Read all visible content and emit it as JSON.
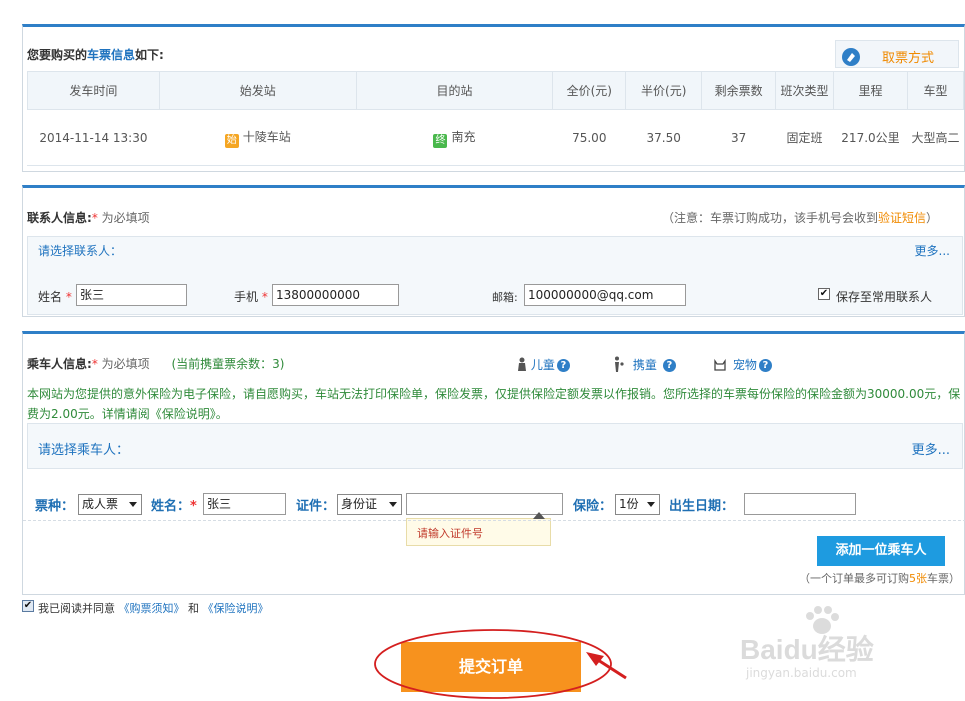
{
  "ticket_panel": {
    "heading_prefix": "您要购买的",
    "heading_highlight": "车票信息",
    "heading_suffix": "如下:",
    "pickup_label": "取票方式",
    "columns": [
      "发车时间",
      "始发站",
      "目的站",
      "全价(元)",
      "半价(元)",
      "剩余票数",
      "班次类型",
      "里程",
      "车型"
    ],
    "row": {
      "depart_time": "2014-11-14 13:30",
      "start_tag": "始",
      "start_station": "十陵车站",
      "end_tag": "终",
      "end_station": "南充",
      "full_price": "75.00",
      "half_price": "37.50",
      "remaining": "37",
      "service_type": "固定班",
      "distance": "217.0公里",
      "vehicle": "大型高二"
    }
  },
  "contact_panel": {
    "heading": "联系人信息:",
    "required_mark": "*",
    "required_text": "为必填项",
    "notice_prefix": "（注意：车票订购成功，该手机号会收到",
    "notice_link": "验证短信",
    "notice_suffix": "）",
    "select_prompt": "请选择联系人：",
    "more": "更多...",
    "name_label": "姓名",
    "name_value": "张三",
    "phone_label": "手机",
    "phone_value": "13800000000",
    "email_label": "邮箱:",
    "email_value": "100000000@qq.com",
    "save_label": "保存至常用联系人",
    "save_checked": "✔"
  },
  "passenger_panel": {
    "heading": "乘车人信息:",
    "required_mark": "*",
    "required_text": "为必填项",
    "child_count": "(当前携童票余数：3)",
    "child_label": "儿童",
    "carry_child_label": "携童",
    "pet_label": "宠物",
    "help_glyph": "?",
    "insurance_notice": "本网站为您提供的意外保险为电子保险，请自愿购买，车站无法打印保险单，保险发票，仅提供保险定额发票以作报销。您所选择的车票每份保险的保险金额为30000.00元，保费为2.00元。详情请阅",
    "insurance_link": "《保险说明》",
    "insurance_end": "。",
    "select_prompt": "请选择乘车人：",
    "more": "更多...",
    "ticket_type_label": "票种：",
    "ticket_type_value": "成人票",
    "name_label": "姓名：",
    "name_value": "张三",
    "id_label": "证件：",
    "id_type_value": "身份证",
    "id_number_value": "",
    "id_tooltip": "请输入证件号",
    "insurance_label": "保险：",
    "insurance_value": "1份",
    "birth_label": "出生日期：",
    "birth_value": "",
    "add_button": "添加一位乘车人",
    "limit_prefix": "（一个订单最多可订购",
    "limit_value": "5张",
    "limit_suffix": "车票）"
  },
  "agreement": {
    "checked": "✔",
    "prefix": "我已阅读并同意",
    "link1": "《购票须知》",
    "and": "和",
    "link2": "《保险说明》"
  },
  "submit": {
    "label": "提交订单"
  },
  "watermark": {
    "brand": "Baidu经验",
    "url": "jingyan.baidu.com"
  },
  "colors": {
    "accent_blue": "#2f7fc7",
    "submit_orange": "#f7921e",
    "add_button_blue": "#1e9be0",
    "annotation_red": "#d41f1f"
  }
}
